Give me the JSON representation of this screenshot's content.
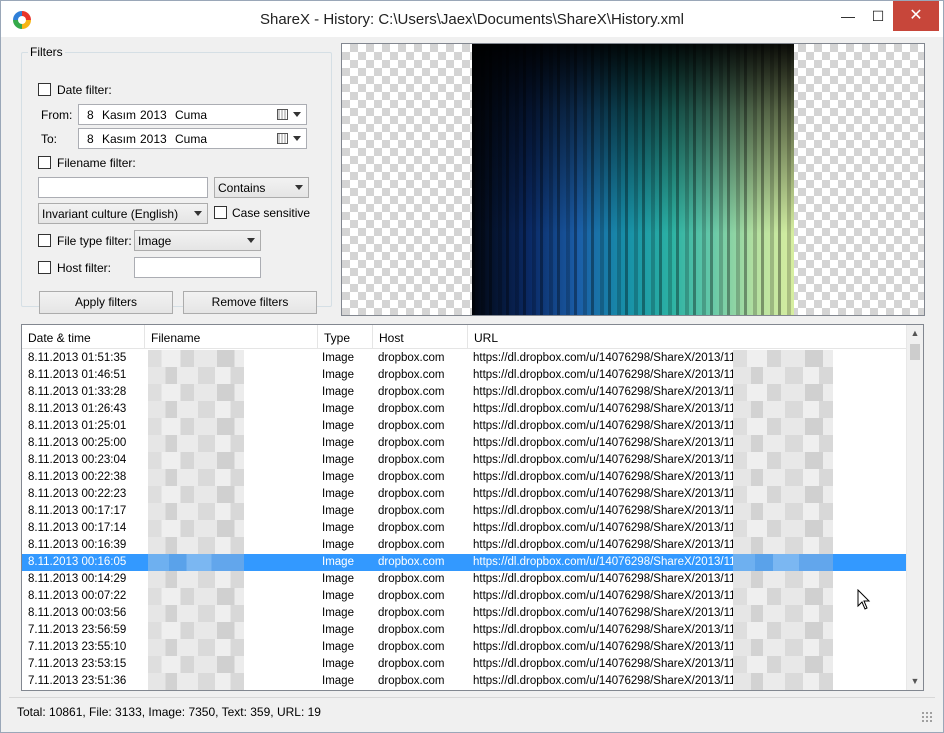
{
  "window": {
    "title": "ShareX - History: C:\\Users\\Jaex\\Documents\\ShareX\\History.xml",
    "minimize_glyph": "—",
    "maximize_glyph": "☐",
    "close_glyph": "✕"
  },
  "filters": {
    "legend": "Filters",
    "date_filter_label": "Date filter:",
    "from_label": "From:",
    "to_label": "To:",
    "from_date": {
      "day": "8",
      "month": "Kasım",
      "year": "2013",
      "weekday": "Cuma"
    },
    "to_date": {
      "day": "8",
      "month": "Kasım",
      "year": "2013",
      "weekday": "Cuma"
    },
    "filename_filter_label": "Filename filter:",
    "filename_value": "",
    "match_mode": "Contains",
    "culture": "Invariant culture (English)",
    "case_sensitive_label": "Case sensitive",
    "file_type_label": "File type filter:",
    "file_type_value": "Image",
    "host_filter_label": "Host filter:",
    "host_value": "",
    "apply_button": "Apply filters",
    "remove_button": "Remove filters"
  },
  "history": {
    "columns": [
      "Date & time",
      "Filename",
      "Type",
      "Host",
      "URL"
    ],
    "selected_index": 12,
    "rows": [
      {
        "date": "8.11.2013 01:51:35",
        "type": "Image",
        "host": "dropbox.com",
        "url": "https://dl.dropbox.com/u/14076298/ShareX/2013/11"
      },
      {
        "date": "8.11.2013 01:46:51",
        "type": "Image",
        "host": "dropbox.com",
        "url": "https://dl.dropbox.com/u/14076298/ShareX/2013/11"
      },
      {
        "date": "8.11.2013 01:33:28",
        "type": "Image",
        "host": "dropbox.com",
        "url": "https://dl.dropbox.com/u/14076298/ShareX/2013/11"
      },
      {
        "date": "8.11.2013 01:26:43",
        "type": "Image",
        "host": "dropbox.com",
        "url": "https://dl.dropbox.com/u/14076298/ShareX/2013/11"
      },
      {
        "date": "8.11.2013 01:25:01",
        "type": "Image",
        "host": "dropbox.com",
        "url": "https://dl.dropbox.com/u/14076298/ShareX/2013/11"
      },
      {
        "date": "8.11.2013 00:25:00",
        "type": "Image",
        "host": "dropbox.com",
        "url": "https://dl.dropbox.com/u/14076298/ShareX/2013/11"
      },
      {
        "date": "8.11.2013 00:23:04",
        "type": "Image",
        "host": "dropbox.com",
        "url": "https://dl.dropbox.com/u/14076298/ShareX/2013/11"
      },
      {
        "date": "8.11.2013 00:22:38",
        "type": "Image",
        "host": "dropbox.com",
        "url": "https://dl.dropbox.com/u/14076298/ShareX/2013/11"
      },
      {
        "date": "8.11.2013 00:22:23",
        "type": "Image",
        "host": "dropbox.com",
        "url": "https://dl.dropbox.com/u/14076298/ShareX/2013/11"
      },
      {
        "date": "8.11.2013 00:17:17",
        "type": "Image",
        "host": "dropbox.com",
        "url": "https://dl.dropbox.com/u/14076298/ShareX/2013/11"
      },
      {
        "date": "8.11.2013 00:17:14",
        "type": "Image",
        "host": "dropbox.com",
        "url": "https://dl.dropbox.com/u/14076298/ShareX/2013/11"
      },
      {
        "date": "8.11.2013 00:16:39",
        "type": "Image",
        "host": "dropbox.com",
        "url": "https://dl.dropbox.com/u/14076298/ShareX/2013/11"
      },
      {
        "date": "8.11.2013 00:16:05",
        "type": "Image",
        "host": "dropbox.com",
        "url": "https://dl.dropbox.com/u/14076298/ShareX/2013/11"
      },
      {
        "date": "8.11.2013 00:14:29",
        "type": "Image",
        "host": "dropbox.com",
        "url": "https://dl.dropbox.com/u/14076298/ShareX/2013/11"
      },
      {
        "date": "8.11.2013 00:07:22",
        "type": "Image",
        "host": "dropbox.com",
        "url": "https://dl.dropbox.com/u/14076298/ShareX/2013/11"
      },
      {
        "date": "8.11.2013 00:03:56",
        "type": "Image",
        "host": "dropbox.com",
        "url": "https://dl.dropbox.com/u/14076298/ShareX/2013/11"
      },
      {
        "date": "7.11.2013 23:56:59",
        "type": "Image",
        "host": "dropbox.com",
        "url": "https://dl.dropbox.com/u/14076298/ShareX/2013/11"
      },
      {
        "date": "7.11.2013 23:55:10",
        "type": "Image",
        "host": "dropbox.com",
        "url": "https://dl.dropbox.com/u/14076298/ShareX/2013/11"
      },
      {
        "date": "7.11.2013 23:53:15",
        "type": "Image",
        "host": "dropbox.com",
        "url": "https://dl.dropbox.com/u/14076298/ShareX/2013/11"
      },
      {
        "date": "7.11.2013 23:51:36",
        "type": "Image",
        "host": "dropbox.com",
        "url": "https://dl.dropbox.com/u/14076298/ShareX/2013/11"
      }
    ]
  },
  "scrollbar": {
    "up_glyph": "▲",
    "down_glyph": "▼"
  },
  "status": {
    "text": "Total: 10861, File: 3133, Image: 7350, Text: 359, URL: 19"
  },
  "colors": {
    "selection": "#3399ff",
    "close_button": "#c7463a"
  }
}
